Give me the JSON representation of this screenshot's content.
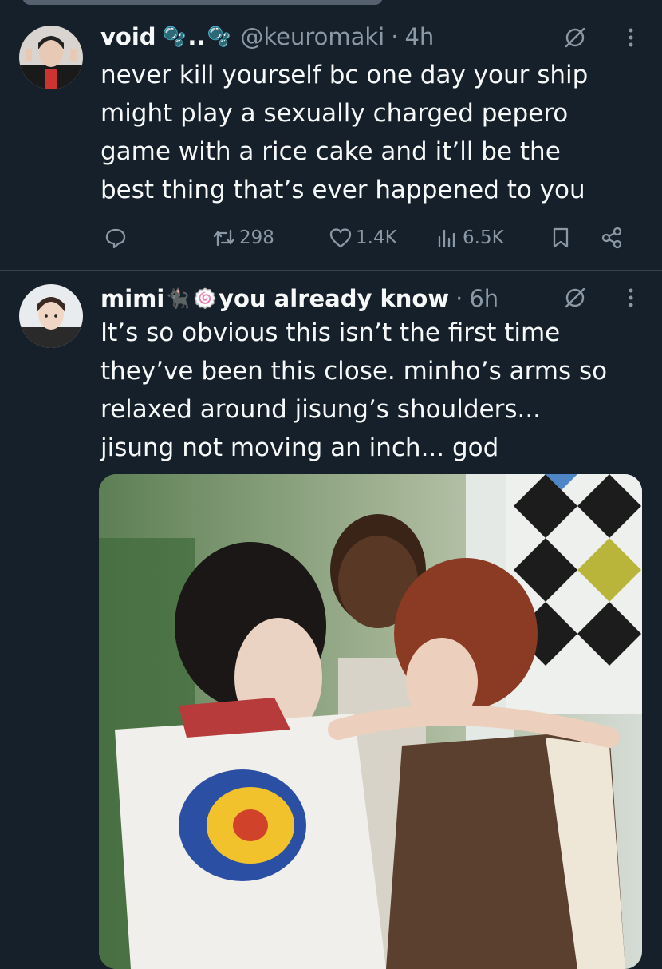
{
  "tweets": [
    {
      "name": "void",
      "name_emoji_1": "🫧",
      "name_dots": "..",
      "name_emoji_2": "🫧",
      "handle": "@keuromaki",
      "separator": "·",
      "time": "4h",
      "lines": [
        "never kill yourself bc one day your ship",
        "might play a sexually charged pepero",
        "game with a rice cake and it’ll be the",
        "best thing that’s ever happened to you"
      ],
      "stats": {
        "retweets": "298",
        "likes": "1.4K",
        "views": "6.5K"
      }
    },
    {
      "name": "mimi",
      "name_emoji_1": "🐈‍⬛",
      "name_emoji_2": "🍥",
      "name_suffix": "you already know",
      "separator": "·",
      "time": "6h",
      "lines": [
        "It’s so obvious this isn’t the first time",
        "they’ve been this close. minho’s arms so",
        "relaxed around jisung’s shoulders...",
        "jisung not moving an inch... god"
      ]
    }
  ],
  "icons": {
    "reply": "reply-icon",
    "retweet": "retweet-icon",
    "like": "heart-icon",
    "views": "views-icon",
    "bookmark": "bookmark-icon",
    "share": "share-icon",
    "grok": "grok-icon",
    "more": "more-icon"
  },
  "colors": {
    "background": "#15202b",
    "text": "#f7f9f9",
    "secondary": "#8b98a5",
    "divider": "#38444d"
  }
}
